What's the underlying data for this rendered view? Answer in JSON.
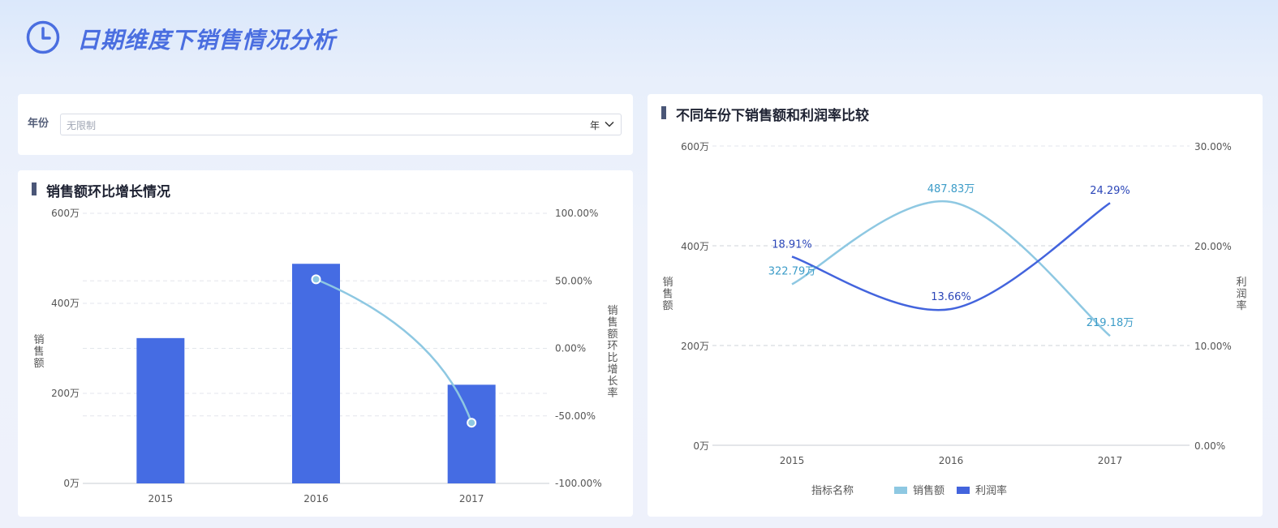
{
  "header": {
    "title": "日期维度下销售情况分析"
  },
  "filter": {
    "label": "年份",
    "placeholder": "无限制",
    "unit": "年"
  },
  "colors": {
    "bar": "#456ce3",
    "line_light": "#8ec8e2",
    "line_dark": "#4364dd",
    "label_dark": "#2b46b8",
    "label_light": "#3c9cc8"
  },
  "chart_data": [
    {
      "type": "bar",
      "title": "销售额环比增长情况",
      "categories": [
        "2015",
        "2016",
        "2017"
      ],
      "series": [
        {
          "type": "bar",
          "axis": "left",
          "values": [
            3227900,
            4878300,
            2191800
          ]
        },
        {
          "type": "line",
          "axis": "right",
          "values": [
            null,
            51.13,
            -55.07
          ]
        }
      ],
      "ylabel": "销售额",
      "y2label": "销售额环比增长率",
      "ylim": [
        0,
        6000000
      ],
      "y2lim": [
        -100,
        100
      ],
      "yticks": [
        "0万",
        "200万",
        "400万",
        "600万"
      ],
      "y2ticks": [
        "100.00%",
        "50.00%",
        "0.00%",
        "-50.00%",
        "-100.00%"
      ],
      "grid": true
    },
    {
      "type": "line",
      "title": "不同年份下销售额和利润率比较",
      "categories": [
        "2015",
        "2016",
        "2017"
      ],
      "series": [
        {
          "name": "销售额",
          "axis": "left",
          "values": [
            3227900,
            4878300,
            2191800
          ],
          "labels": [
            "322.79万",
            "487.83万",
            "219.18万"
          ]
        },
        {
          "name": "利润率",
          "axis": "right",
          "values": [
            18.91,
            13.66,
            24.29
          ],
          "labels": [
            "18.91%",
            "13.66%",
            "24.29%"
          ]
        }
      ],
      "ylabel": "销售额",
      "y2label": "利润率",
      "ylim": [
        0,
        6000000
      ],
      "y2lim": [
        0,
        30
      ],
      "yticks": [
        "0万",
        "200万",
        "400万",
        "600万"
      ],
      "y2ticks": [
        "0.00%",
        "10.00%",
        "20.00%",
        "30.00%"
      ],
      "legend": {
        "title": "指标名称",
        "position": "bottom"
      },
      "grid": true
    }
  ]
}
